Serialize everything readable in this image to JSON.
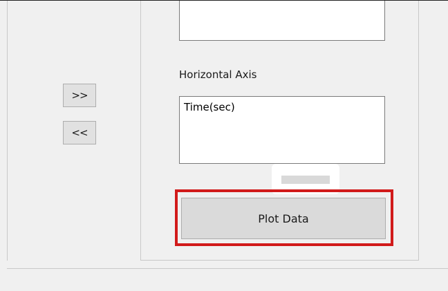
{
  "controls": {
    "move_right_label": ">>",
    "move_left_label": "<<"
  },
  "horizontal_axis": {
    "label": "Horizontal Axis",
    "items": [
      "Time(sec)"
    ]
  },
  "plot_button": {
    "label": "Plot Data"
  },
  "colors": {
    "background": "#f0f0f0",
    "highlight": "#d11a1a",
    "button_face": "#dadada"
  }
}
